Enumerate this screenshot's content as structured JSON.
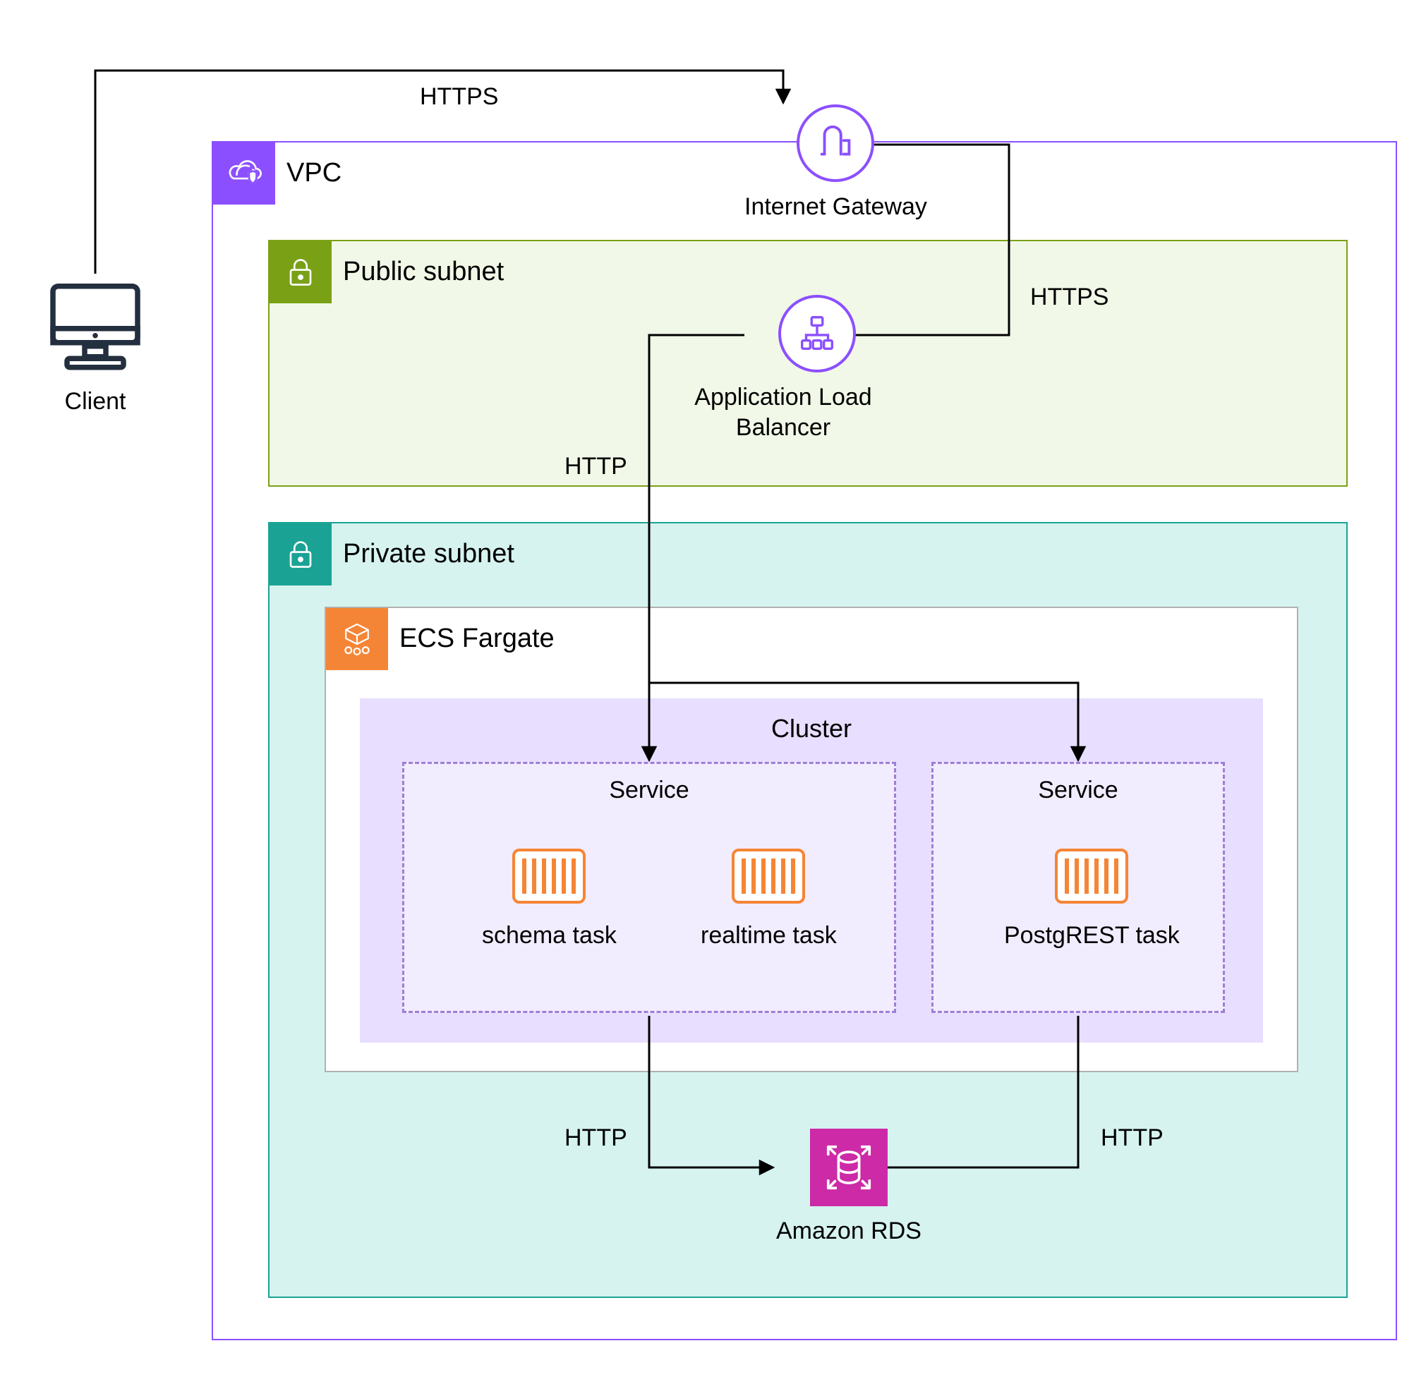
{
  "client": {
    "label": "Client"
  },
  "edges": {
    "client_to_igw": "HTTPS",
    "igw_to_alb": "HTTPS",
    "alb_to_service1": "HTTP",
    "service1_to_rds": "HTTP",
    "service2_to_rds": "HTTP"
  },
  "vpc": {
    "label": "VPC"
  },
  "public_subnet": {
    "label": "Public subnet"
  },
  "private_subnet": {
    "label": "Private subnet"
  },
  "igw": {
    "label": "Internet Gateway"
  },
  "alb": {
    "label": "Application Load\nBalancer"
  },
  "ecs": {
    "label": "ECS Fargate"
  },
  "cluster": {
    "label": "Cluster",
    "services": [
      {
        "label": "Service",
        "tasks": [
          "schema task",
          "realtime task"
        ]
      },
      {
        "label": "Service",
        "tasks": [
          "PostgREST task"
        ]
      }
    ]
  },
  "rds": {
    "label": "Amazon RDS"
  }
}
